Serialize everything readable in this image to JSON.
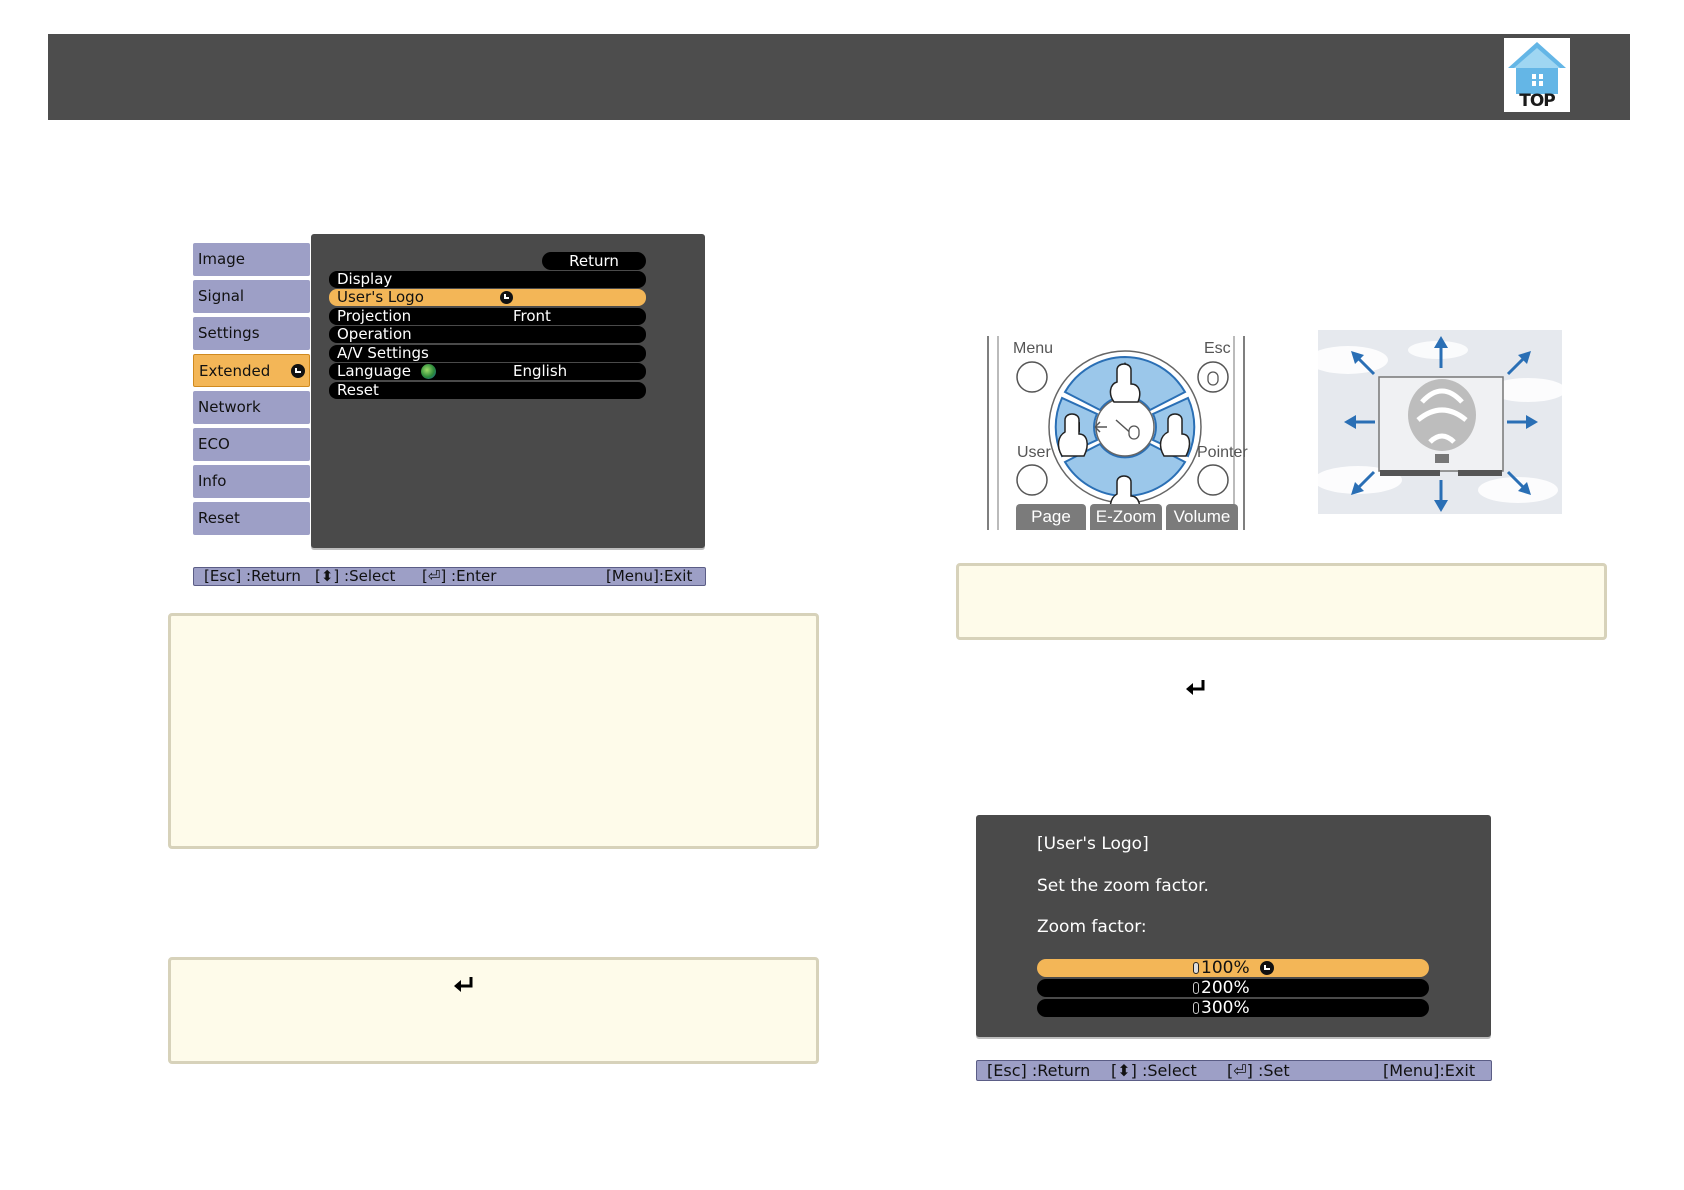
{
  "header": {
    "top_logo_label": "TOP"
  },
  "projector_menu": {
    "tabs": [
      "Image",
      "Signal",
      "Settings",
      "Extended",
      "Network",
      "ECO",
      "Info",
      "Reset"
    ],
    "active_tab": "Extended",
    "return_label": "Return",
    "items": [
      {
        "label": "Display",
        "value": ""
      },
      {
        "label": "User's Logo",
        "value": ""
      },
      {
        "label": "Projection",
        "value": "Front"
      },
      {
        "label": "Operation",
        "value": ""
      },
      {
        "label": "A/V Settings",
        "value": ""
      },
      {
        "label": "Language",
        "value": "English"
      },
      {
        "label": "Reset",
        "value": ""
      }
    ],
    "selected_item": "User's Logo",
    "status": {
      "esc": "[Esc] :Return",
      "select": "[⬍] :Select",
      "enter": "[⏎] :Enter",
      "menu": "[Menu]:Exit"
    }
  },
  "remote": {
    "labels": {
      "menu": "Menu",
      "esc": "Esc",
      "user": "User",
      "pointer": "Pointer"
    },
    "tabs": {
      "page": "Page",
      "ezoom": "E-Zoom",
      "volume": "Volume"
    }
  },
  "zoom_dialog": {
    "title": "[User's Logo]",
    "instruction": "Set the zoom factor.",
    "zoom_label": "Zoom factor:",
    "options": [
      "100%",
      "200%",
      "300%"
    ],
    "selected_option": "100%",
    "status": {
      "esc": "[Esc] :Return",
      "select": "[⬍] :Select",
      "set": "[⏎] :Set",
      "menu": "[Menu]:Exit"
    }
  },
  "colors": {
    "header": "#4d4d4d",
    "menu_tab": "#9d9fc6",
    "highlight": "#f3b657",
    "note_fill": "#fefbea",
    "arrow_blue": "#2a6fb5"
  }
}
